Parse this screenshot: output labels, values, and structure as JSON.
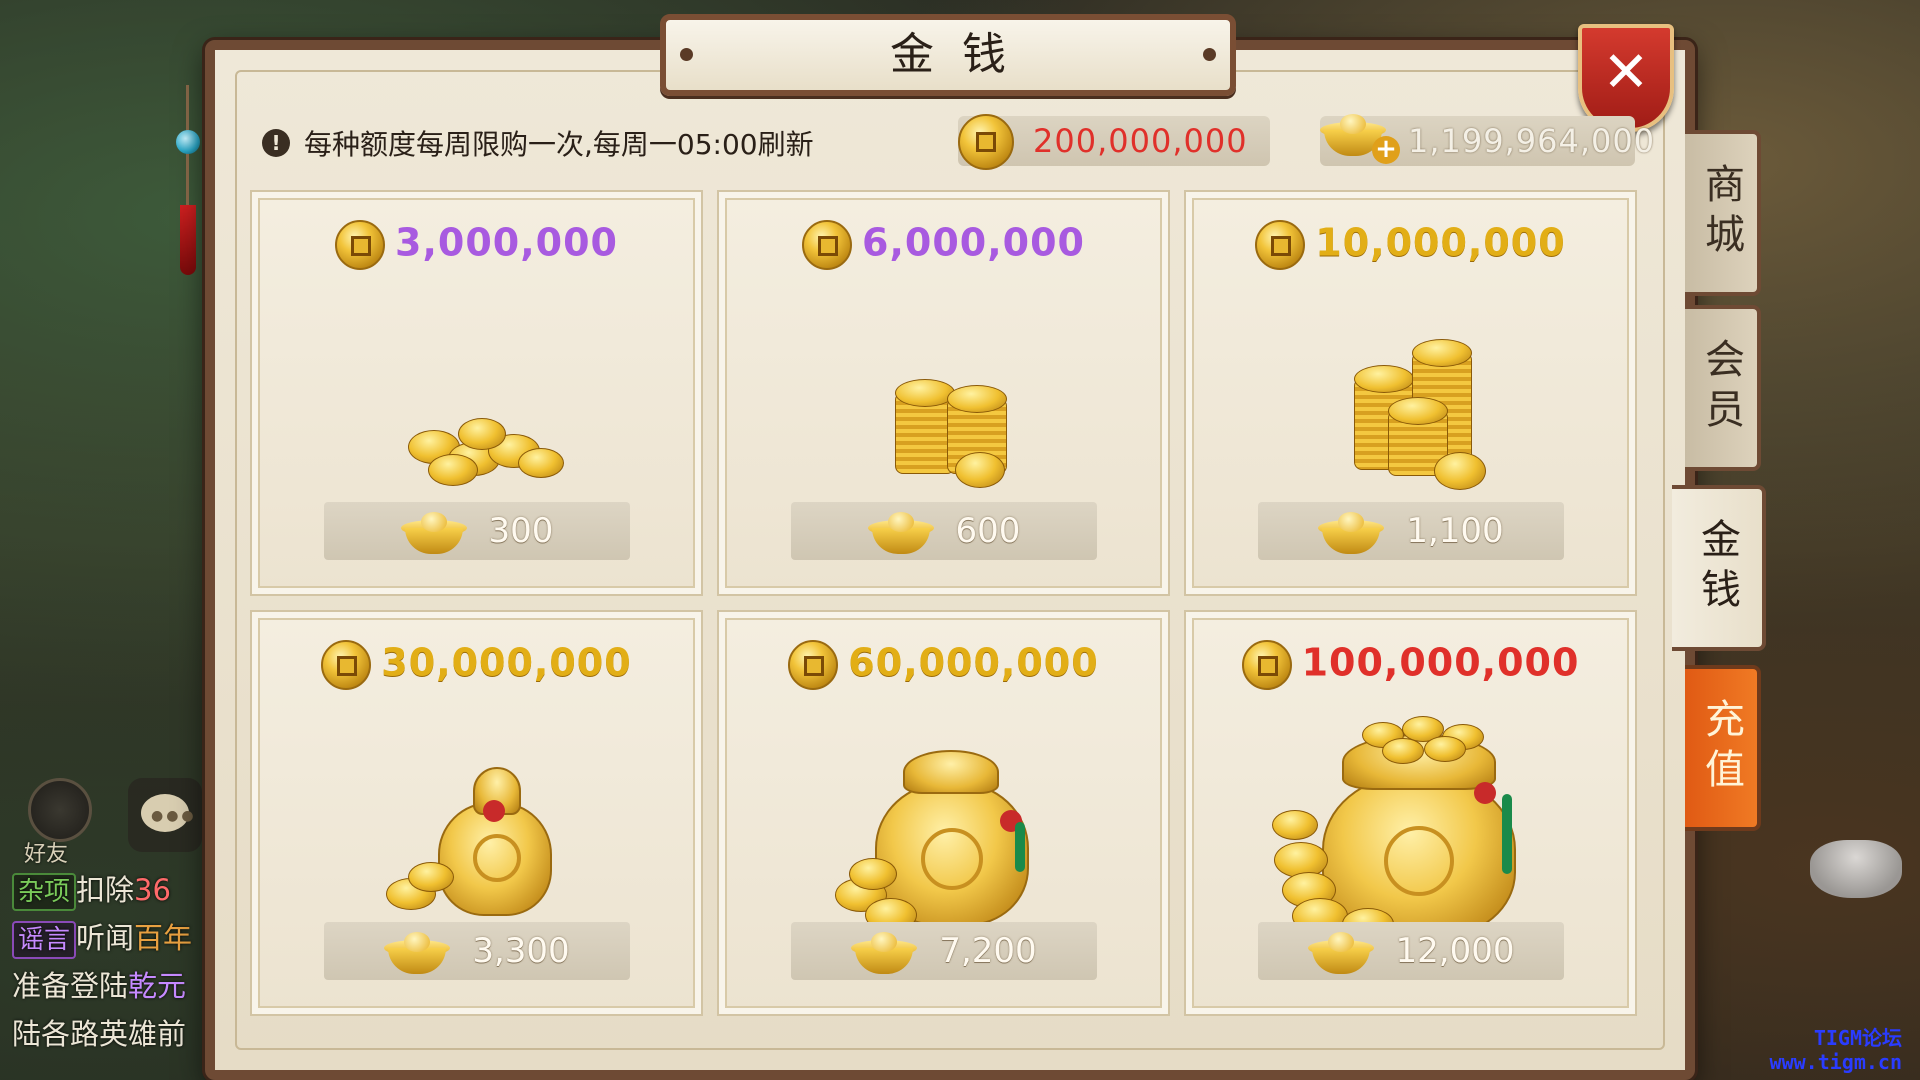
{
  "hud": {
    "friends_label": "好友",
    "chat_log": [
      {
        "tag": "杂项",
        "text": "扣除",
        "hl": "36",
        "hl_class": "c-red",
        "tag_class": ""
      },
      {
        "tag": "谣言",
        "text": "听闻",
        "hl": "百年",
        "hl_class": "c-orange",
        "tag_class": "purple"
      },
      {
        "tag": "",
        "text": "准备登陆",
        "hl": "乾元",
        "hl_class": "c-purple",
        "tag_class": ""
      },
      {
        "tag": "",
        "text": "陆各路英雄前",
        "hl": "",
        "hl_class": "",
        "tag_class": ""
      }
    ],
    "watermark_line1": "TIGM论坛",
    "watermark_line2": "www.tigm.cn"
  },
  "panel": {
    "title": "金钱",
    "close_label": "✕",
    "notice": "每种额度每周限购一次,每周一05:00刷新",
    "notice_icon": "!",
    "coin_balance": "200,000,000",
    "ingot_balance": "1,199,964,000",
    "ingot_plus": "+"
  },
  "packages": [
    {
      "amount": "3,000,000",
      "amount_color": "purple",
      "price": "300",
      "art": "small-pile"
    },
    {
      "amount": "6,000,000",
      "amount_color": "purple",
      "price": "600",
      "art": "stacks"
    },
    {
      "amount": "10,000,000",
      "amount_color": "gold",
      "price": "1,100",
      "art": "tall-stacks"
    },
    {
      "amount": "30,000,000",
      "amount_color": "gold",
      "price": "3,300",
      "art": "small-bag"
    },
    {
      "amount": "60,000,000",
      "amount_color": "gold",
      "price": "7,200",
      "art": "medium-bag"
    },
    {
      "amount": "100,000,000",
      "amount_color": "red",
      "price": "12,000",
      "art": "large-bag"
    }
  ],
  "side_tabs": [
    {
      "label": "商城",
      "state": "normal"
    },
    {
      "label": "会员",
      "state": "normal"
    },
    {
      "label": "金钱",
      "state": "active"
    },
    {
      "label": "充值",
      "state": "recharge"
    }
  ],
  "colors": {
    "amount_purple": "#a85ae0",
    "amount_gold": "#e2ae16",
    "amount_red": "#e0302a",
    "panel_frame": "#6e4a34",
    "recharge_tab": "#f07a24"
  },
  "icons": {
    "coin": "copper-coin-icon",
    "ingot": "gold-ingot-icon",
    "close": "close-icon",
    "notice": "exclamation-icon",
    "chat": "chat-bubble-icon",
    "friends": "friends-icon"
  }
}
